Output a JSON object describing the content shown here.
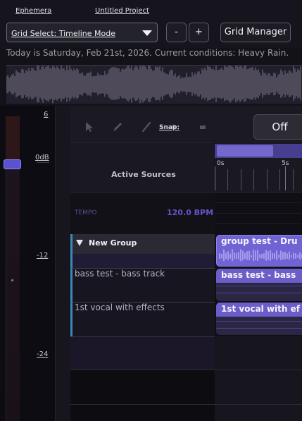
{
  "topbar": {
    "app_link": "Ephemera",
    "project_link": "Untitled Project"
  },
  "controls": {
    "grid_select_value": "Grid Select: Timeline Mode",
    "zoom_out_label": "-",
    "zoom_in_label": "+",
    "grid_manager_label": "Grid Manager"
  },
  "status": {
    "conditions_text": "Today is Saturday, Feb 21st, 2026. Current conditions: Heavy Rain."
  },
  "meter": {
    "labels": [
      "6",
      "0dB",
      "-12",
      "-24"
    ]
  },
  "toolbar": {
    "snap_label": "Snap:",
    "snap_value": "Off",
    "tools": [
      "pointer-icon",
      "pencil-icon",
      "line-icon",
      "dot-icon",
      "erase-icon"
    ]
  },
  "sources": {
    "header": "Active Sources"
  },
  "ruler": {
    "labels": [
      "0s",
      "5s"
    ]
  },
  "tempo": {
    "label": "TEMPO",
    "value": "120.0 BPM"
  },
  "group": {
    "name": "New Group"
  },
  "tracks": [
    {
      "name": "bass test - bass track",
      "clip": "bass test - bass"
    },
    {
      "name": "1st vocal with effects",
      "clip": "1st vocal with ef"
    }
  ],
  "group_clip": "group test - Dru",
  "colors": {
    "accent": "#5a52cf",
    "clip": "#6f5fd0",
    "group_border": "#3d88b4"
  }
}
